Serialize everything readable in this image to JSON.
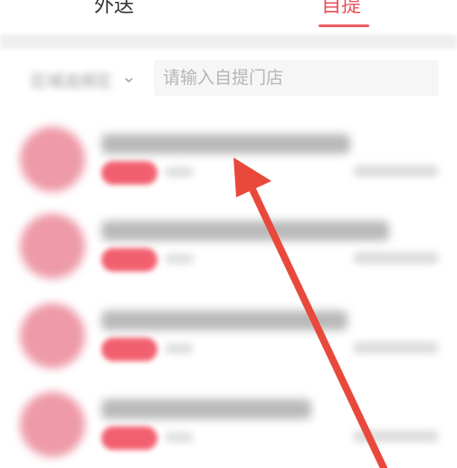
{
  "tabs": {
    "items": [
      {
        "label": "外送"
      },
      {
        "label": "自提"
      }
    ],
    "active_index": 1
  },
  "search": {
    "region_label": "区域选择区",
    "placeholder": "请输入自提门店"
  },
  "stores": [
    {
      "name": "",
      "tag": "",
      "distance": ""
    },
    {
      "name": "",
      "tag": "",
      "distance": ""
    },
    {
      "name": "",
      "tag": "",
      "distance": ""
    },
    {
      "name": "",
      "tag": "",
      "distance": ""
    }
  ],
  "colors": {
    "accent": "#e8505b",
    "arrow": "#e8493c",
    "tag": "#f2606f"
  }
}
